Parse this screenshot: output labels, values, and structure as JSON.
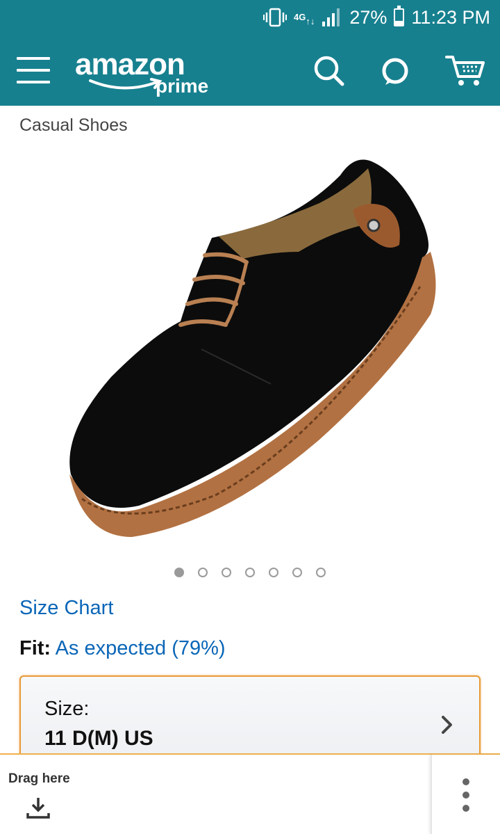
{
  "status_bar": {
    "network": "4G",
    "battery_percent": "27%",
    "battery_level": 0.27,
    "time": "11:23 PM",
    "icons": [
      "vibrate-icon",
      "lte-icon",
      "signal-icon",
      "battery-icon"
    ]
  },
  "app_bar": {
    "logo_word": "amazon",
    "logo_sub": "prime",
    "icons": [
      "menu-icon",
      "search-icon",
      "alexa-icon",
      "cart-icon"
    ]
  },
  "product": {
    "category": "Casual Shoes",
    "image_count": 7,
    "active_image_index": 0
  },
  "links": {
    "size_chart": "Size Chart"
  },
  "fit": {
    "label": "Fit:",
    "value": "As expected (79%)"
  },
  "size_selector": {
    "label": "Size:",
    "value": "11 D(M) US"
  },
  "bottom_overlay": {
    "drag_label": "Drag here"
  },
  "colors": {
    "brand_teal": "#17808f",
    "link_blue": "#0a66b7",
    "highlight_orange": "#e79a36"
  }
}
